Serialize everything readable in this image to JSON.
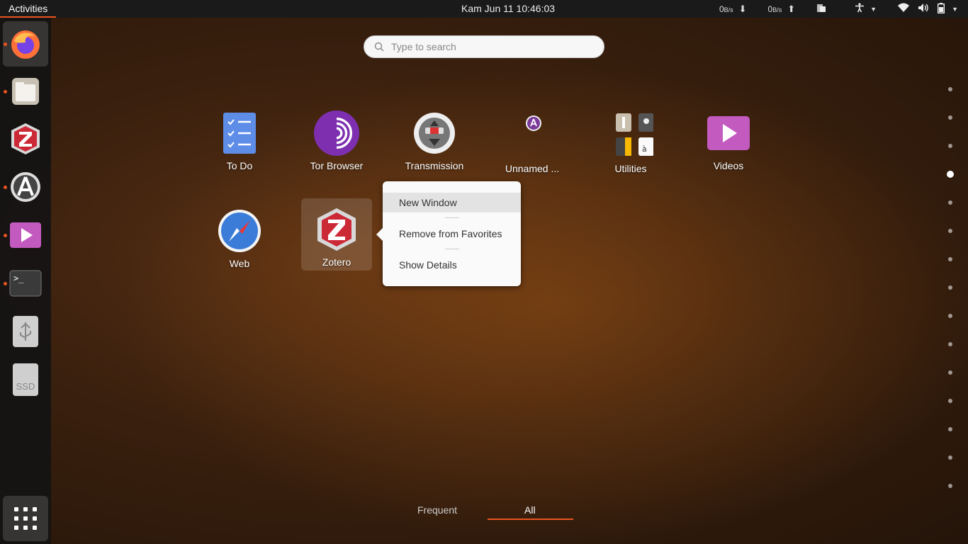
{
  "topbar": {
    "activities": "Activities",
    "clock": "Kam Jun 11  10:46:03",
    "net_down": "0",
    "net_down_unit": "B/s",
    "net_up": "0",
    "net_up_unit": "B/s",
    "icons": [
      "download-arrow-icon",
      "upload-arrow-icon",
      "clipboard-icon",
      "accessibility-icon",
      "chevron-down-icon",
      "wifi-icon",
      "volume-icon",
      "battery-icon",
      "chevron-down-icon"
    ]
  },
  "dock": {
    "items": [
      {
        "name": "Firefox",
        "icon": "firefox-icon",
        "running": true,
        "active": true
      },
      {
        "name": "Files",
        "icon": "files-icon",
        "running": true,
        "active": false
      },
      {
        "name": "Zotero",
        "icon": "zotero-icon",
        "running": false,
        "active": false
      },
      {
        "name": "Software",
        "icon": "software-icon",
        "running": true,
        "active": false
      },
      {
        "name": "Videos",
        "icon": "videos-icon",
        "running": true,
        "active": false
      },
      {
        "name": "Terminal",
        "icon": "terminal-icon",
        "running": true,
        "active": false
      },
      {
        "name": "USB",
        "icon": "usb-drive-icon",
        "running": false,
        "active": false
      },
      {
        "name": "SSD",
        "icon": "ssd-drive-icon",
        "running": false,
        "active": false
      }
    ],
    "ssd_label": "SSD",
    "show_apps": "show-applications-icon"
  },
  "search": {
    "placeholder": "Type to search"
  },
  "apps": [
    {
      "label": "To Do",
      "icon": "todo-icon"
    },
    {
      "label": "Tor Browser",
      "icon": "tor-browser-icon"
    },
    {
      "label": "Transmission",
      "icon": "transmission-icon"
    },
    {
      "label": "Unnamed ...",
      "icon": "folder-unnamed-icon"
    },
    {
      "label": "Utilities",
      "icon": "utilities-folder-icon"
    },
    {
      "label": "Videos",
      "icon": "videos-icon"
    },
    {
      "label": "Web",
      "icon": "web-browser-icon"
    },
    {
      "label": "Zotero",
      "icon": "zotero-icon"
    }
  ],
  "context_menu": {
    "items": [
      "New Window",
      "Remove from Favorites",
      "Show Details"
    ]
  },
  "page_indicator": {
    "count": 15,
    "current": 4
  },
  "tabs": {
    "frequent": "Frequent",
    "all": "All",
    "selected": "All"
  },
  "colors": {
    "accent": "#e95420",
    "topbar": "#1a1a1a",
    "menu_bg": "#fafafa"
  }
}
